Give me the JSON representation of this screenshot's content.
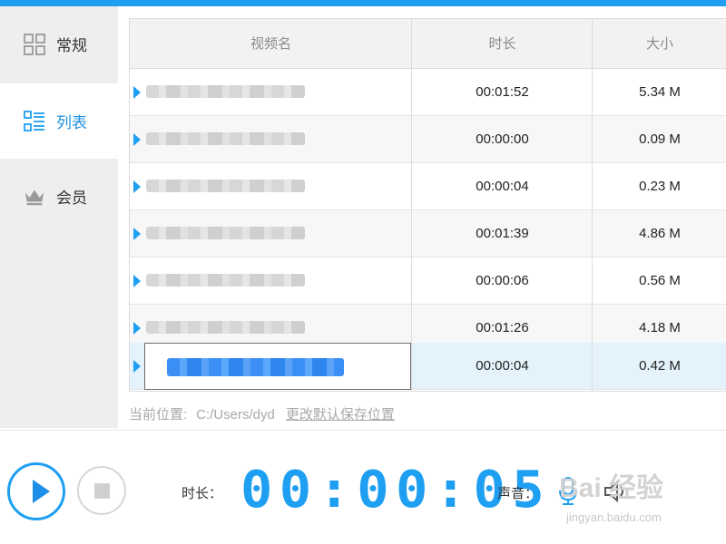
{
  "sidebar": {
    "items": [
      {
        "label": "常规",
        "icon": "grid-icon"
      },
      {
        "label": "列表",
        "icon": "list-icon",
        "active": true
      },
      {
        "label": "会员",
        "icon": "crown-icon"
      }
    ]
  },
  "table": {
    "headers": {
      "name": "视频名",
      "duration": "时长",
      "size": "大小"
    },
    "rows": [
      {
        "duration": "00:01:52",
        "size": "5.34 M"
      },
      {
        "duration": "00:00:00",
        "size": "0.09 M"
      },
      {
        "duration": "00:00:04",
        "size": "0.23 M"
      },
      {
        "duration": "00:01:39",
        "size": "4.86 M"
      },
      {
        "duration": "00:00:06",
        "size": "0.56 M"
      },
      {
        "duration": "00:01:26",
        "size": "4.18 M"
      },
      {
        "duration": "00:00:04",
        "size": "0.42 M",
        "selected": true
      }
    ]
  },
  "location": {
    "label": "当前位置:",
    "path": "C:/Users/dyd",
    "change_link": "更改默认保存位置"
  },
  "player": {
    "duration_label": "时长：",
    "timer": "00:00:05",
    "sound_label": "声音：",
    "mic_icon": "microphone-icon",
    "speaker_icon": "speaker-icon"
  },
  "watermark": {
    "logo": "Bai 经验",
    "url": "jingyan.baidu.com"
  },
  "colors": {
    "accent": "#1e9ff2",
    "selected_row": "#e3f2fb",
    "sidebar_bg": "#eeeeee"
  }
}
